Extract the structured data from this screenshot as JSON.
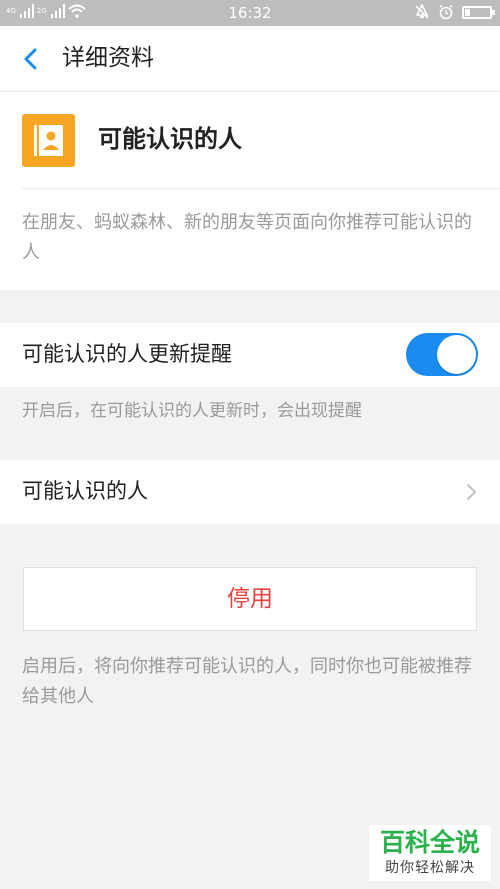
{
  "status_bar": {
    "signal1_label": "4G",
    "signal2_label": "2G",
    "time": "16:32"
  },
  "header": {
    "title": "详细资料"
  },
  "app": {
    "name": "可能认识的人",
    "description": "在朋友、蚂蚁森林、新的朋友等页面向你推荐可能认识的人",
    "icon_color": "#f6a623"
  },
  "settings": {
    "update_reminder_label": "可能认识的人更新提醒",
    "update_reminder_enabled": true,
    "update_reminder_hint": "开启后，在可能认识的人更新时，会出现提醒",
    "people_entry_label": "可能认识的人",
    "toggle_color": "#1a8cf0"
  },
  "actions": {
    "disable_label": "停用",
    "disable_color": "#e64340",
    "description": "启用后，将向你推荐可能认识的人，同时你也可能被推荐给其他人"
  },
  "watermark": {
    "main": "百科全说",
    "sub": "助你轻松解决"
  }
}
